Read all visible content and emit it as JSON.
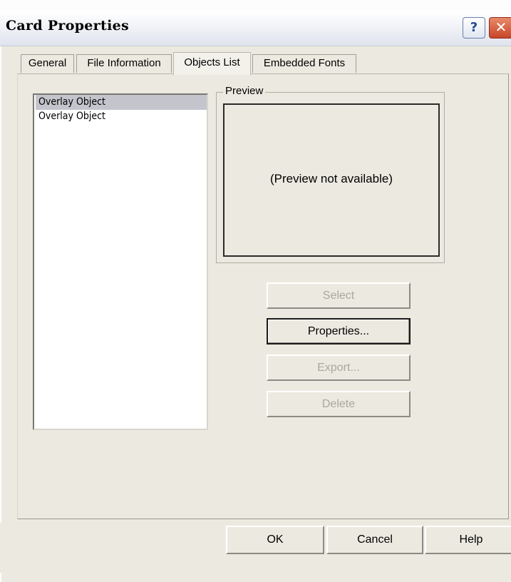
{
  "window": {
    "title": "Card Properties",
    "help_glyph": "?",
    "close_glyph": "✕"
  },
  "tabs": [
    {
      "label": "General"
    },
    {
      "label": "File Information"
    },
    {
      "label": "Objects List",
      "active": true
    },
    {
      "label": "Embedded Fonts"
    }
  ],
  "objects_list": {
    "items": [
      "Overlay Object",
      "Overlay Object"
    ],
    "selected_index": 0
  },
  "preview": {
    "group_label": "Preview",
    "message": "(Preview not available)"
  },
  "actions": {
    "select": "Select",
    "properties": "Properties...",
    "export": "Export...",
    "delete": "Delete"
  },
  "footer": {
    "ok": "OK",
    "cancel": "Cancel",
    "help": "Help"
  },
  "colors": {
    "face": "#eceae0",
    "selection": "#c4c4cc",
    "close_red": "#c84527"
  }
}
